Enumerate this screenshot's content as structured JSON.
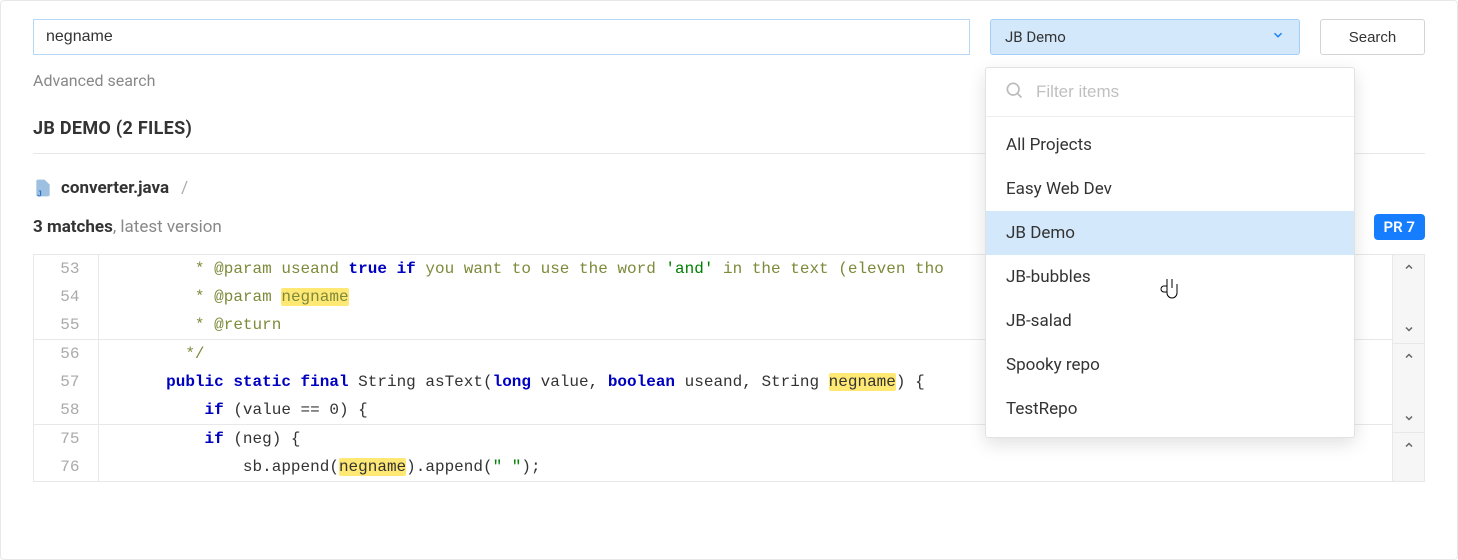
{
  "search": {
    "value": "negname",
    "button": "Search",
    "advanced": "Advanced search"
  },
  "selector": {
    "label": "JB Demo",
    "filter_placeholder": "Filter items",
    "options": {
      "o0": "All Projects",
      "o1": "Easy Web Dev",
      "o2": "JB Demo",
      "o3": "JB-bubbles",
      "o4": "JB-salad",
      "o5": "Spooky repo",
      "o6": "TestRepo"
    }
  },
  "section": {
    "header": "JB Demo (2 files)"
  },
  "file": {
    "name": "converter.java",
    "sep": "/",
    "matches_count": "3 matches",
    "matches_note": ", latest version",
    "badge": "PR 7"
  },
  "code": {
    "l53": {
      "n": "53",
      "t1": " * ",
      "t2": "@param",
      "t3": " useand ",
      "t4": "true",
      "t5": " ",
      "t6": "if",
      "t7": " you want to use the word ",
      "t8": "'and'",
      "t9": " in the text (eleven tho"
    },
    "l54": {
      "n": "54",
      "t1": " * ",
      "t2": "@param",
      "t3": " ",
      "hl": "negname"
    },
    "l55": {
      "n": "55",
      "t1": " * ",
      "t2": "@return"
    },
    "l56": {
      "n": "56",
      "t1": " */"
    },
    "l57": {
      "n": "57",
      "kw1": "public",
      "kw2": "static",
      "kw3": "final",
      "t1": " String asText(",
      "kw4": "long",
      "t2": " value, ",
      "kw5": "boolean",
      "t3": " useand, String ",
      "hl": "negname",
      "t4": ") {"
    },
    "l58": {
      "n": "58",
      "kw1": "if",
      "t1": " (value == ",
      "num": "0",
      "t2": ") {"
    },
    "l75": {
      "n": "75",
      "kw1": "if",
      "t1": " (neg) {"
    },
    "l76": {
      "n": "76",
      "t1": "sb.append(",
      "hl": "negname",
      "t2": ").append(",
      "str": "\" \"",
      "t3": ");"
    }
  }
}
